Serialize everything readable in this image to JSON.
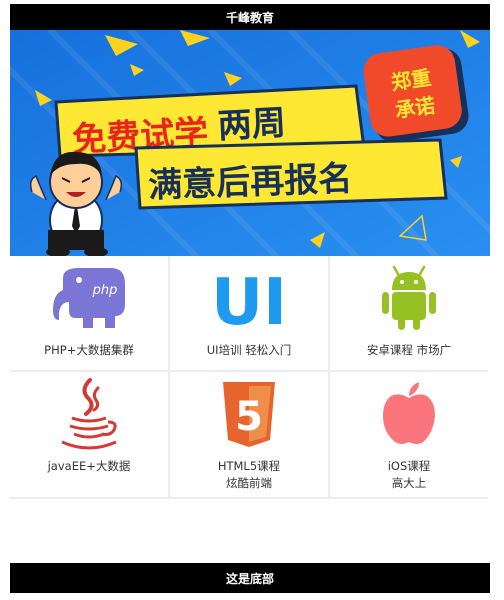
{
  "header": {
    "title": "千峰教育"
  },
  "banner": {
    "line1_red": "免费试学",
    "line1_dark": "两周",
    "line2": "满意后再报名",
    "badge_line1": "郑重",
    "badge_line2": "承诺"
  },
  "courses": [
    {
      "icon": "php-elephant-icon",
      "line1": "PHP+大数据集群",
      "line2": ""
    },
    {
      "icon": "ui-icon",
      "icon_text": "UI",
      "line1": "UI培训 轻松入门",
      "line2": ""
    },
    {
      "icon": "android-icon",
      "line1": "安卓课程 市场广",
      "line2": ""
    },
    {
      "icon": "java-cup-icon",
      "line1": "javaEE+大数据",
      "line2": ""
    },
    {
      "icon": "html5-icon",
      "icon_text": "5",
      "line1": "HTML5课程",
      "line2": "炫酷前端"
    },
    {
      "icon": "apple-icon",
      "line1": "iOS课程",
      "line2": "高大上"
    }
  ],
  "footer": {
    "text": "这是底部"
  },
  "colors": {
    "bar": "#000000",
    "banner_blue": "#1f7fe0",
    "banner_yellow": "#ffe833",
    "banner_red": "#e8241c",
    "php_purple": "#7b76d6",
    "ui_blue": "#1e9af0",
    "android_green": "#97c024",
    "java_red": "#d23a33",
    "html5_orange": "#e8642e",
    "apple_red": "#fb767c"
  }
}
